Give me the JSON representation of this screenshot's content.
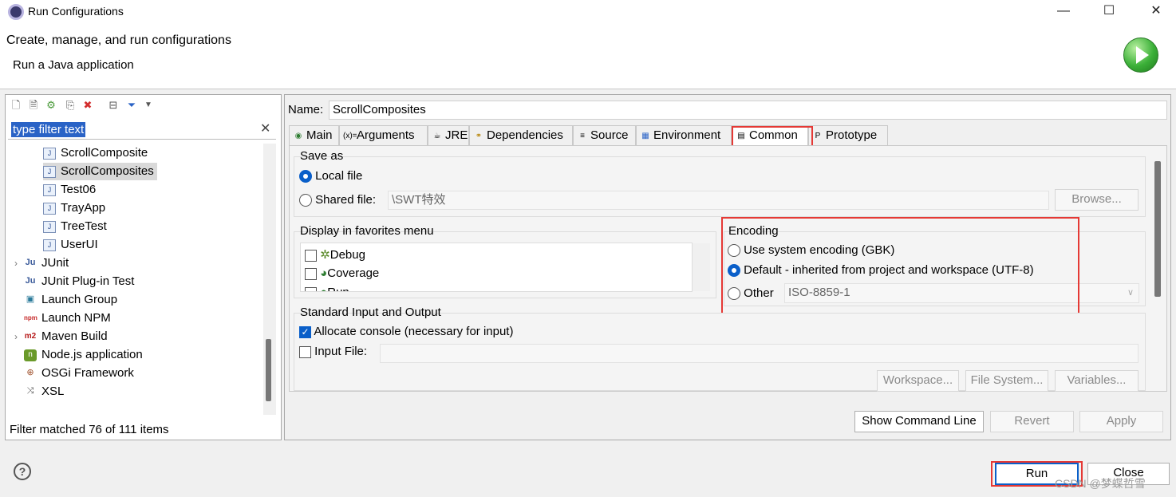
{
  "window": {
    "title": "Run Configurations",
    "minimize": "—",
    "maximize": "☐",
    "close": "✕"
  },
  "header": {
    "title": "Create, manage, and run configurations",
    "subtitle": "Run a Java application"
  },
  "left": {
    "filter_placeholder": "type filter text",
    "tree": [
      {
        "label": "ScrollComposite",
        "icon": "java-app-icon"
      },
      {
        "label": "ScrollComposites",
        "icon": "java-app-icon",
        "selected": true
      },
      {
        "label": "Test06",
        "icon": "java-app-icon"
      },
      {
        "label": "TrayApp",
        "icon": "java-app-icon"
      },
      {
        "label": "TreeTest",
        "icon": "java-app-icon"
      },
      {
        "label": "UserUI",
        "icon": "java-app-icon"
      },
      {
        "label": "JUnit",
        "icon": "junit-icon"
      },
      {
        "label": "JUnit Plug-in Test",
        "icon": "junit-plugin-icon"
      },
      {
        "label": "Launch Group",
        "icon": "launch-group-icon"
      },
      {
        "label": "Launch NPM",
        "icon": "npm-icon"
      },
      {
        "label": "Maven Build",
        "icon": "maven-icon"
      },
      {
        "label": "Node.js application",
        "icon": "nodejs-icon"
      },
      {
        "label": "OSGi Framework",
        "icon": "osgi-icon"
      },
      {
        "label": "XSL",
        "icon": "xsl-icon"
      }
    ],
    "status": "Filter matched 76 of 111 items"
  },
  "right": {
    "name_label": "Name:",
    "name_value": "ScrollComposites",
    "tabs": [
      "Main",
      "Arguments",
      "JRE",
      "Dependencies",
      "Source",
      "Environment",
      "Common",
      "Prototype"
    ],
    "active_tab": "Common",
    "save_as": {
      "title": "Save as",
      "local_file": "Local file",
      "shared_file": "Shared file:",
      "shared_path": "\\SWT特效",
      "browse": "Browse..."
    },
    "favorites": {
      "title": "Display in favorites menu",
      "items": [
        "Debug",
        "Coverage",
        "Run"
      ]
    },
    "encoding": {
      "title": "Encoding",
      "system": "Use system encoding (GBK)",
      "default": "Default - inherited from project and workspace (UTF-8)",
      "other": "Other",
      "other_value": "ISO-8859-1"
    },
    "stdio": {
      "title": "Standard Input and Output",
      "allocate": "Allocate console (necessary for input)",
      "input_file": "Input File:",
      "workspace": "Workspace...",
      "filesystem": "File System...",
      "variables": "Variables..."
    },
    "show_cmd": "Show Command Line",
    "revert": "Revert",
    "apply": "Apply"
  },
  "footer": {
    "run": "Run",
    "close": "Close",
    "watermark": "CSDN @梦蝶哲雪"
  },
  "colors": {
    "accent": "#0a5fc9",
    "highlight_box": "#e53935",
    "selection": "#2a63c6"
  }
}
